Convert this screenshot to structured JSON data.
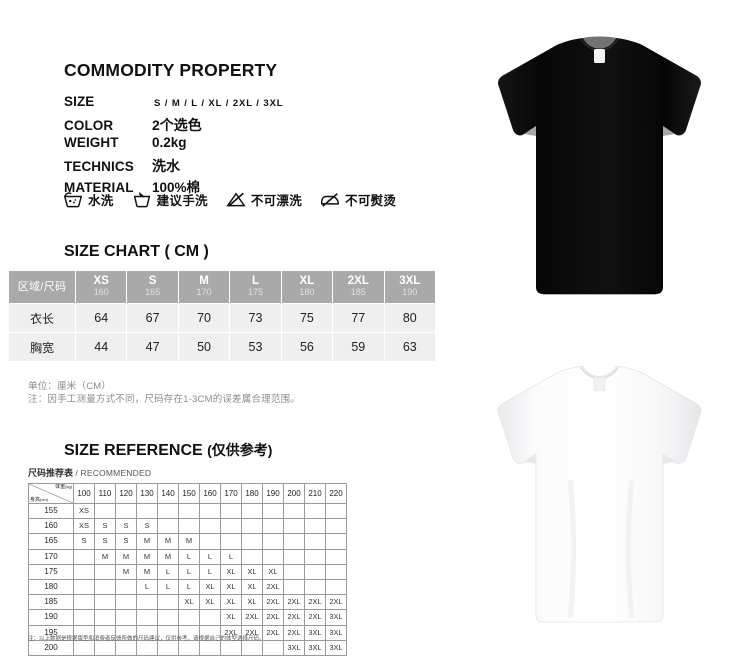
{
  "commodity": {
    "title": "COMMODITY PROPERTY",
    "properties": [
      {
        "key": "SIZE",
        "value": "S / M / L / XL / 2XL / 3XL",
        "style": "tiny"
      },
      {
        "key": "COLOR",
        "value": "2个选色",
        "style": "cn"
      },
      {
        "key": "WEIGHT",
        "value": "0.2kg",
        "style": "num"
      },
      {
        "key": "TECHNICS",
        "value": "洗水",
        "style": "cn"
      },
      {
        "key": "MATERIAL",
        "value": "100%棉",
        "style": "num"
      }
    ],
    "care": [
      {
        "icon": "wash-tub-icon",
        "label": "水洗"
      },
      {
        "icon": "hand-wash-icon",
        "label": "建议手洗"
      },
      {
        "icon": "no-bleach-icon",
        "label": "不可漂洗"
      },
      {
        "icon": "no-ironing-icon",
        "label": "不可熨烫"
      }
    ]
  },
  "size_chart": {
    "title": "SIZE CHART ( CM )",
    "corner_label": "区域/尺码",
    "columns": [
      {
        "size": "XS",
        "height": "160"
      },
      {
        "size": "S",
        "height": "165"
      },
      {
        "size": "M",
        "height": "170"
      },
      {
        "size": "L",
        "height": "175"
      },
      {
        "size": "XL",
        "height": "180"
      },
      {
        "size": "2XL",
        "height": "185"
      },
      {
        "size": "3XL",
        "height": "190"
      }
    ],
    "rows": [
      {
        "label": "衣长",
        "values": [
          "64",
          "67",
          "70",
          "73",
          "75",
          "77",
          "80"
        ]
      },
      {
        "label": "胸宽",
        "values": [
          "44",
          "47",
          "50",
          "53",
          "56",
          "59",
          "63"
        ]
      }
    ],
    "notes": [
      "单位：厘米（CM）",
      "注：因手工测量方式不同，尺码存在1-3CM的误差属合理范围。"
    ]
  },
  "size_reference": {
    "title_main": "SIZE REFERENCE",
    "title_sub": "(仅供参考)",
    "caption_cn": "尺码推荐表",
    "caption_en": "/ RECOMMENDED",
    "corner_weight": "体重",
    "corner_weight_unit": "(kg)",
    "corner_height": "身高",
    "corner_height_unit": "(cm)",
    "weights": [
      "100",
      "110",
      "120",
      "130",
      "140",
      "150",
      "160",
      "170",
      "180",
      "190",
      "200",
      "210",
      "220"
    ],
    "heights": [
      "155",
      "160",
      "165",
      "170",
      "175",
      "180",
      "185",
      "190",
      "195",
      "200"
    ],
    "grid": [
      [
        "XS",
        "",
        "",
        "",
        "",
        "",
        "",
        "",
        "",
        "",
        "",
        "",
        ""
      ],
      [
        "XS",
        "S",
        "S",
        "S",
        "",
        "",
        "",
        "",
        "",
        "",
        "",
        "",
        ""
      ],
      [
        "S",
        "S",
        "S",
        "M",
        "M",
        "M",
        "",
        "",
        "",
        "",
        "",
        "",
        ""
      ],
      [
        "",
        "M",
        "M",
        "M",
        "M",
        "L",
        "L",
        "L",
        "",
        "",
        "",
        "",
        ""
      ],
      [
        "",
        "",
        "M",
        "M",
        "L",
        "L",
        "L",
        "XL",
        "XL",
        "XL",
        "",
        "",
        ""
      ],
      [
        "",
        "",
        "",
        "L",
        "L",
        "L",
        "XL",
        "XL",
        "XL",
        "2XL",
        "",
        "",
        ""
      ],
      [
        "",
        "",
        "",
        "",
        "",
        "XL",
        "XL",
        "XL",
        "XL",
        "2XL",
        "2XL",
        "2XL",
        "2XL"
      ],
      [
        "",
        "",
        "",
        "",
        "",
        "",
        "",
        "XL",
        "2XL",
        "2XL",
        "2XL",
        "2XL",
        "3XL"
      ],
      [
        "",
        "",
        "",
        "",
        "",
        "",
        "",
        "2XL",
        "2XL",
        "2XL",
        "2XL",
        "3XL",
        "3XL"
      ],
      [
        "",
        "",
        "",
        "",
        "",
        "",
        "",
        "",
        "",
        "",
        "3XL",
        "3XL",
        "3XL"
      ]
    ],
    "note": "注：以上数据是根据版型和消费者反馈所做的尺码建议，仅供参考，请根据自己的体型选择尺码。"
  },
  "product_images": [
    {
      "name": "black-tshirt-image",
      "color": "#0b0b0b",
      "alt": "黑色圆领短袖T恤"
    },
    {
      "name": "white-tshirt-image",
      "color": "#fdfdfd",
      "alt": "白色圆领短袖T恤"
    }
  ],
  "palette": {
    "header_gray": "#a9a9a9",
    "row_gray": "#efefef",
    "note_gray": "#8c8c8c",
    "fit_xs": "#ffffff",
    "fit_s": "#f2f2f2",
    "fit_m": "#e3e3e3",
    "fit_l": "#c9c9c9",
    "fit_xl": "#a8a8a8",
    "fit_2xl": "#8a8a8a",
    "fit_3xl": "#5e5e5e"
  }
}
